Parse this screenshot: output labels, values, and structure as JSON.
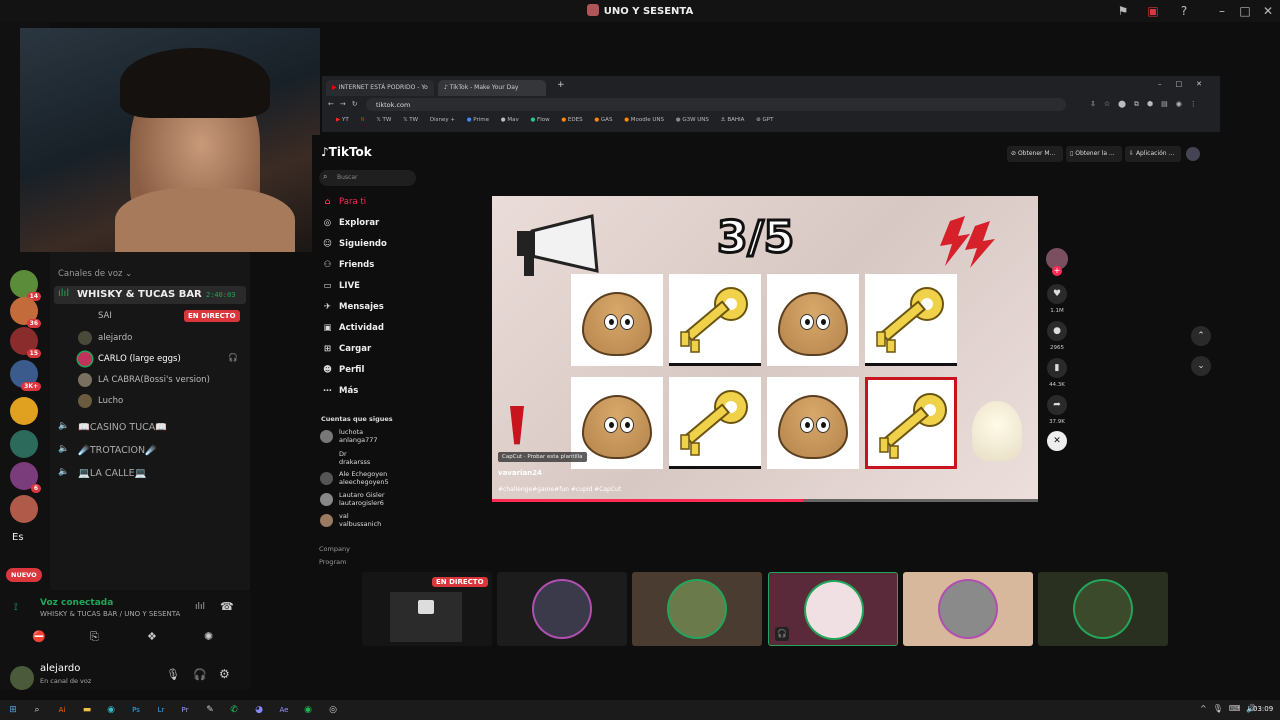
{
  "window": {
    "title": "UNO Y SESENTA"
  },
  "browser": {
    "tabs": [
      {
        "label": "INTERNET ESTÁ PODRIDO - Yo"
      },
      {
        "label": "TikTok - Make Your Day"
      }
    ],
    "new_tab": "+",
    "url": "tiktok.com",
    "bookmarks": [
      "YT",
      "N",
      "TW",
      "TW",
      "Disney +",
      "Prime",
      "Mav",
      "Flow",
      "EDES",
      "GAS",
      "Moodle UNS",
      "G3W UNS",
      "BAHIA",
      "GPT"
    ]
  },
  "tiktok": {
    "logo": "TikTok",
    "search_placeholder": "Buscar",
    "nav": [
      {
        "label": "Para ti",
        "icon": "home-icon",
        "active": true
      },
      {
        "label": "Explorar",
        "icon": "compass-icon"
      },
      {
        "label": "Siguiendo",
        "icon": "following-icon"
      },
      {
        "label": "Friends",
        "icon": "friends-icon"
      },
      {
        "label": "LIVE",
        "icon": "live-icon"
      },
      {
        "label": "Mensajes",
        "icon": "messages-icon"
      },
      {
        "label": "Actividad",
        "icon": "activity-icon"
      },
      {
        "label": "Cargar",
        "icon": "upload-icon"
      },
      {
        "label": "Perfil",
        "icon": "profile-icon"
      },
      {
        "label": "Más",
        "icon": "more-icon"
      }
    ],
    "following_title": "Cuentas que sigues",
    "following": [
      {
        "name": "luchota",
        "handle": "anlanga777"
      },
      {
        "name": "Dr",
        "handle": "drakarsss"
      },
      {
        "name": "Ale Echegoyen",
        "handle": "aleechegoyen5"
      },
      {
        "name": "Lautaro Gisler",
        "handle": "lautarogisler6"
      },
      {
        "name": "val",
        "handle": "valbussanich"
      }
    ],
    "footer": [
      "Company",
      "Program"
    ],
    "header_buttons": [
      "Obtener M...",
      "Obtener la ...",
      "Aplicación ..."
    ],
    "video": {
      "score": "3/5",
      "template_tag": "CapCut · Probar esta plantilla",
      "author": "vavarian24",
      "caption": "#challenge#game#fun #cupid #CapCut",
      "progress": 0.57,
      "cards": [
        "pou",
        "key",
        "pou",
        "key",
        "pou",
        "key",
        "pou",
        "key"
      ]
    },
    "actions": [
      {
        "icon": "heart-icon",
        "count": "1.1M"
      },
      {
        "icon": "comment-icon",
        "count": "2965"
      },
      {
        "icon": "bookmark-icon",
        "count": "44.3K"
      },
      {
        "icon": "share-icon",
        "count": "37.9K"
      }
    ]
  },
  "discord": {
    "server_badges": [
      "14",
      "36",
      "15",
      "3K+",
      "6"
    ],
    "server_text": "Es",
    "new_badge": "NUEVO",
    "voice_category": "Canales de voz",
    "active_channel": {
      "name": "WHISKY & TUCAS BAR",
      "timer": "2:40:03"
    },
    "members": [
      {
        "name": "SAI",
        "live": "EN DIRECTO"
      },
      {
        "name": "alejardo"
      },
      {
        "name": "CARLO (large eggs)"
      },
      {
        "name": "LA CABRA(Bossi's version)"
      },
      {
        "name": "Lucho"
      }
    ],
    "other_channels": [
      "📖CASINO TUCA📖",
      "☄️TROTACION☄️",
      "💻LA CALLE💻"
    ],
    "voice_status": "Voz conectada",
    "voice_location": "WHISKY & TUCAS BAR / UNO Y SESENTA",
    "user": {
      "name": "alejardo",
      "status": "En canal de voz"
    },
    "stream_live": "EN DIRECTO"
  },
  "taskbar": {
    "time": "03:09"
  },
  "colors": {
    "accent": "#fe2c55",
    "live_red": "#da373c",
    "discord_green": "#23a55a"
  }
}
